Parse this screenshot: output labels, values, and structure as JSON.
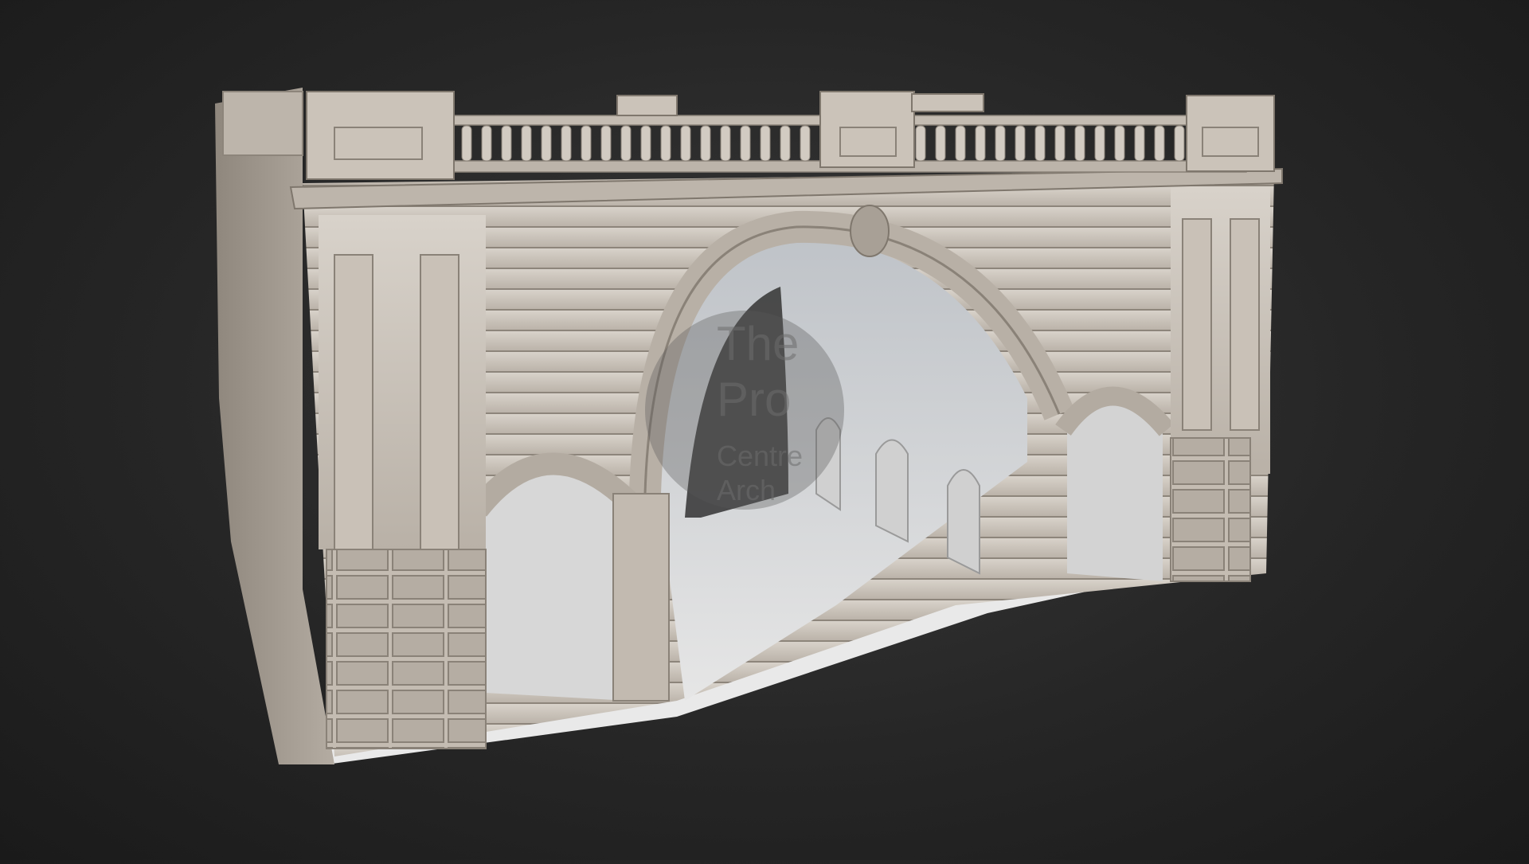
{
  "scene": {
    "subject": "photogrammetry-scan-of-arched-stone-bridge-gateway",
    "background_color": "#262626",
    "stone_color": "#cfc7bd"
  },
  "watermark": {
    "line1": "The",
    "line2": "Pro",
    "line3": "Centre",
    "line4": "Arch"
  }
}
